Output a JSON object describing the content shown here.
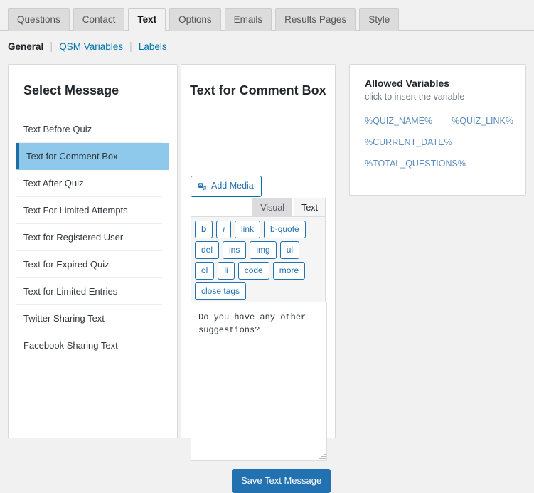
{
  "tabs": [
    {
      "label": "Questions",
      "active": false
    },
    {
      "label": "Contact",
      "active": false
    },
    {
      "label": "Text",
      "active": true
    },
    {
      "label": "Options",
      "active": false
    },
    {
      "label": "Emails",
      "active": false
    },
    {
      "label": "Results Pages",
      "active": false
    },
    {
      "label": "Style",
      "active": false
    }
  ],
  "subnav": [
    {
      "label": "General",
      "current": true
    },
    {
      "label": "QSM Variables",
      "current": false
    },
    {
      "label": "Labels",
      "current": false
    }
  ],
  "select_panel": {
    "title": "Select Message",
    "items": [
      {
        "label": "Text Before Quiz",
        "selected": false
      },
      {
        "label": "Text for Comment Box",
        "selected": true
      },
      {
        "label": "Text After Quiz",
        "selected": false
      },
      {
        "label": "Text For Limited Attempts",
        "selected": false
      },
      {
        "label": "Text for Registered User",
        "selected": false
      },
      {
        "label": "Text for Expired Quiz",
        "selected": false
      },
      {
        "label": "Text for Limited Entries",
        "selected": false
      },
      {
        "label": "Twitter Sharing Text",
        "selected": false
      },
      {
        "label": "Facebook Sharing Text",
        "selected": false
      }
    ]
  },
  "editor_panel": {
    "title": "Text for Comment Box",
    "add_media_label": "Add Media",
    "add_media_icon": "media-camera-music-icon",
    "editor_tabs": [
      {
        "label": "Visual",
        "active": false
      },
      {
        "label": "Text",
        "active": true
      }
    ],
    "quicktags": [
      {
        "label": "b",
        "style": "bold"
      },
      {
        "label": "i",
        "style": "italic"
      },
      {
        "label": "link",
        "style": "underline"
      },
      {
        "label": "b-quote",
        "style": "plain"
      },
      {
        "label": "del",
        "style": "strike"
      },
      {
        "label": "ins",
        "style": "plain"
      },
      {
        "label": "img",
        "style": "plain"
      },
      {
        "label": "ul",
        "style": "plain"
      },
      {
        "label": "ol",
        "style": "plain"
      },
      {
        "label": "li",
        "style": "plain"
      },
      {
        "label": "code",
        "style": "plain"
      },
      {
        "label": "more",
        "style": "plain"
      },
      {
        "label": "close tags",
        "style": "plain"
      }
    ],
    "textarea_value": "Do you have any other suggestions?",
    "textarea_placeholder": "",
    "save_label": "Save Text Message"
  },
  "vars_panel": {
    "title": "Allowed Variables",
    "subtitle": "click to insert the variable",
    "rows": [
      [
        "%QUIZ_NAME%",
        "%QUIZ_LINK%"
      ],
      [
        "%CURRENT_DATE%"
      ],
      [
        "%TOTAL_QUESTIONS%"
      ]
    ]
  },
  "colors": {
    "accent": "#2271b1",
    "selected_row_bg": "#8ec8ea",
    "selected_row_bar": "#1c6ea4",
    "link": "#0073aa",
    "page_bg": "#f1f1f1"
  }
}
